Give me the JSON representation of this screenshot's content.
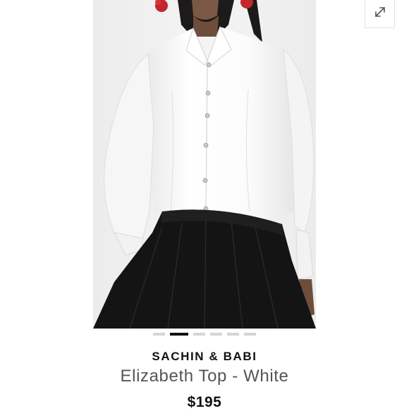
{
  "product": {
    "brand": "SACHIN & BABI",
    "name": "Elizabeth Top - White",
    "price": "$195"
  },
  "gallery": {
    "image_alt": "Model wearing white button-up blouse with black pleated skirt",
    "image_count": 6,
    "active_index": 1,
    "expand_icon": "expand-diagonal-icon"
  },
  "colors": {
    "shirt": "#ffffff",
    "skirt": "#121212",
    "dot_active": "#111111",
    "dot_inactive": "#d5d5d5"
  }
}
